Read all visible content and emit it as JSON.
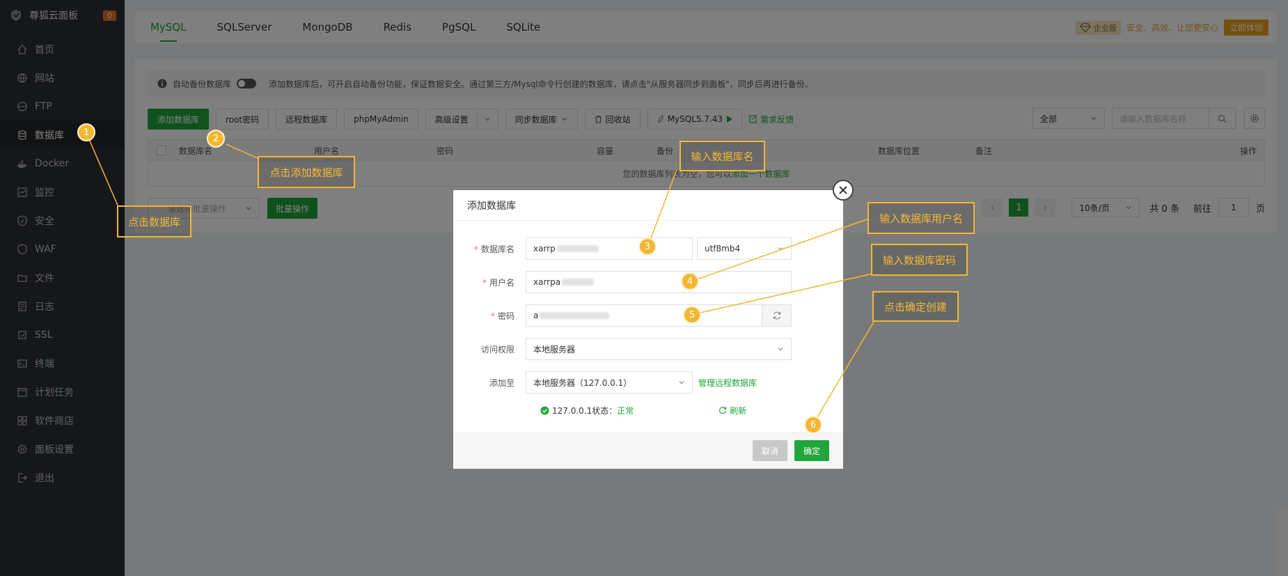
{
  "sidebar": {
    "brand": "尊狐云面板",
    "badge": "0",
    "items": [
      {
        "label": "首页",
        "icon": "home-icon"
      },
      {
        "label": "网站",
        "icon": "globe-icon"
      },
      {
        "label": "FTP",
        "icon": "ftp-icon"
      },
      {
        "label": "数据库",
        "icon": "database-icon",
        "active": true
      },
      {
        "label": "Docker",
        "icon": "docker-icon"
      },
      {
        "label": "监控",
        "icon": "monitor-icon"
      },
      {
        "label": "安全",
        "icon": "shield-icon"
      },
      {
        "label": "WAF",
        "icon": "waf-icon"
      },
      {
        "label": "文件",
        "icon": "folder-icon"
      },
      {
        "label": "日志",
        "icon": "log-icon"
      },
      {
        "label": "SSL",
        "icon": "ssl-icon"
      },
      {
        "label": "终端",
        "icon": "terminal-icon"
      },
      {
        "label": "计划任务",
        "icon": "calendar-icon"
      },
      {
        "label": "软件商店",
        "icon": "store-icon"
      },
      {
        "label": "面板设置",
        "icon": "settings-icon"
      },
      {
        "label": "退出",
        "icon": "logout-icon"
      }
    ]
  },
  "tabs": [
    "MySQL",
    "SQLServer",
    "MongoDB",
    "Redis",
    "PgSQL",
    "SQLite"
  ],
  "topbar": {
    "enterprise_label": "企业版",
    "safe_text": "安全、高效、让您更安心",
    "try_label": "立即体验"
  },
  "notice": {
    "backup_label": "自动备份数据库",
    "text": "添加数据库后，可开启自动备份功能，保证数据安全。通过第三方/Mysql命令行创建的数据库，请点击\"从服务器同步到面板\"，同步后再进行备份。"
  },
  "toolbar": {
    "add_db": "添加数据库",
    "root_pwd": "root密码",
    "remote_db": "远程数据库",
    "phpmyadmin": "phpMyAdmin",
    "advanced": "高级设置",
    "sync": "同步数据库",
    "recycle": "回收站",
    "mysql_version": "MySQL5.7.43",
    "feedback": "需求反馈",
    "filter_all": "全部",
    "search_placeholder": "请输入数据库名称"
  },
  "table": {
    "headers": [
      "数据库名",
      "用户名",
      "密码",
      "容量",
      "备份",
      "数据库位置",
      "备注",
      "操作"
    ],
    "empty_prefix": "您的数据库列表为空，您可以",
    "empty_link": "添加一个数据库"
  },
  "footer": {
    "batch_select": "请选择批量操作",
    "batch_btn": "批量操作",
    "page": "1",
    "per_page": "10条/页",
    "total": "共 0 条",
    "goto_label": "前往",
    "goto_value": "1",
    "page_suffix": "页"
  },
  "modal": {
    "title": "添加数据库",
    "db_name_label": "数据库名",
    "db_name_value": "xarrp",
    "charset": "utf8mb4",
    "username_label": "用户名",
    "username_value": "xarrpa",
    "password_label": "密码",
    "password_value": "a",
    "access_label": "访问权限",
    "access_value": "本地服务器",
    "add_to_label": "添加至",
    "add_to_value": "本地服务器（127.0.0.1）",
    "manage_remote": "管理远程数据库",
    "status_prefix": "127.0.0.1状态：",
    "status_value": "正常",
    "refresh": "刷新",
    "cancel": "取消",
    "confirm": "确定"
  },
  "annotations": {
    "c1": "点击数据库",
    "c2": "点击添加数据库",
    "c3": "输入数据库名",
    "c4": "输入数据库用户名",
    "c5": "输入数据库密码",
    "c6": "点击确定创建",
    "steps": [
      "1",
      "2",
      "3",
      "4",
      "5",
      "6"
    ]
  },
  "colors": {
    "accent": "#20a53a",
    "annotation": "#f5b731",
    "sidebar_bg": "#2c2f36"
  }
}
